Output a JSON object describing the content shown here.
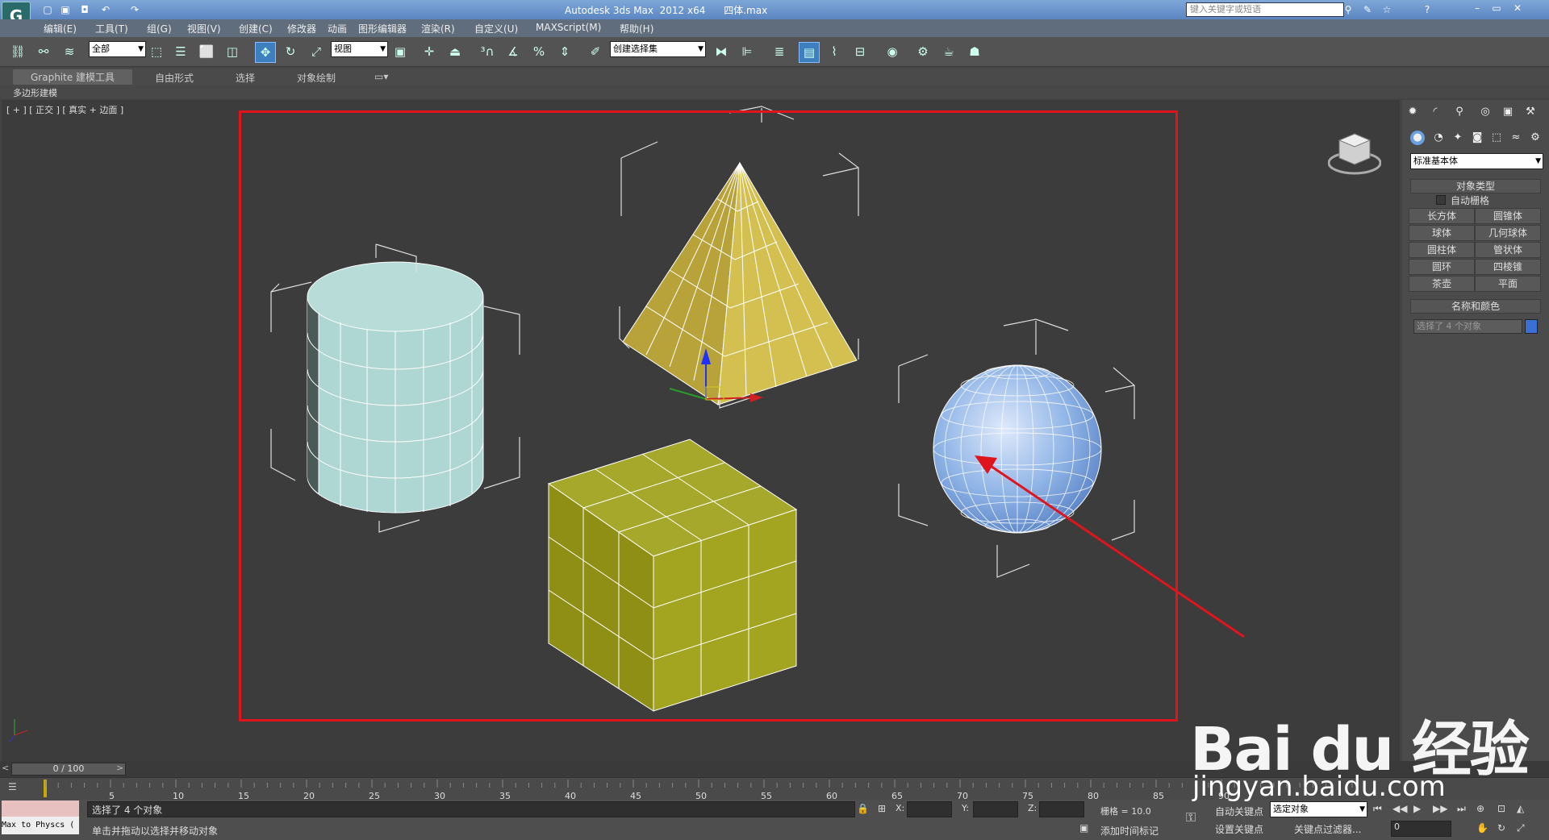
{
  "titlebar": {
    "app_title": "Autodesk 3ds Max  2012 x64      四体.max",
    "search_placeholder": "键入关键字或短语"
  },
  "menu": [
    "编辑(E)",
    "工具(T)",
    "组(G)",
    "视图(V)",
    "创建(C)",
    "修改器",
    "动画",
    "图形编辑器",
    "渲染(R)",
    "自定义(U)",
    "MAXScript(M)",
    "帮助(H)"
  ],
  "toolbar": {
    "selection_filter": "全部",
    "ref_coord": "视图",
    "named_selection": "创建选择集"
  },
  "ribbon": {
    "tabs": [
      "Graphite 建模工具",
      "自由形式",
      "选择",
      "对象绘制"
    ],
    "sub_label": "多边形建模"
  },
  "viewport": {
    "label": "[ + ] [ 正交 ] [ 真实 + 边面 ]"
  },
  "command_panel": {
    "category": "标准基本体",
    "object_type_header": "对象类型",
    "autogrid_label": "自动栅格",
    "buttons": [
      "长方体",
      "圆锥体",
      "球体",
      "几何球体",
      "圆柱体",
      "管状体",
      "圆环",
      "四棱锥",
      "茶壶",
      "平面"
    ],
    "name_color_header": "名称和颜色",
    "name_field": "选择了 4 个对象",
    "object_color": "#3a6fd4"
  },
  "timeline": {
    "frame_slider": "0 / 100",
    "ticks": [
      "5",
      "10",
      "15",
      "20",
      "25",
      "30",
      "35",
      "40",
      "45",
      "50",
      "55",
      "60",
      "65",
      "70",
      "75",
      "80",
      "85",
      "90"
    ]
  },
  "status": {
    "max_to_physx": "Max to Physcs (",
    "selected_text": "选择了 4 个对象",
    "prompt_text": "单击并拖动以选择并移动对象",
    "x_label": "X:",
    "y_label": "Y:",
    "z_label": "Z:",
    "grid_text": "栅格 = 10.0",
    "add_time_tag": "添加时间标记",
    "auto_key": "自动关键点",
    "set_key": "设置关键点",
    "key_mode": "选定对象",
    "key_filters": "关键点过滤器...",
    "frame_value": "0"
  },
  "watermark": {
    "brand": "Bai du 经验",
    "url": "jingyan.baidu.com"
  },
  "colors": {
    "selection_rect": "#e0141c",
    "arrow": "#e0141c",
    "cylinder": "#b8dcd8",
    "pyramid": "#c8b440",
    "box": "#a8aa28",
    "sphere": "#8fb4e6"
  }
}
